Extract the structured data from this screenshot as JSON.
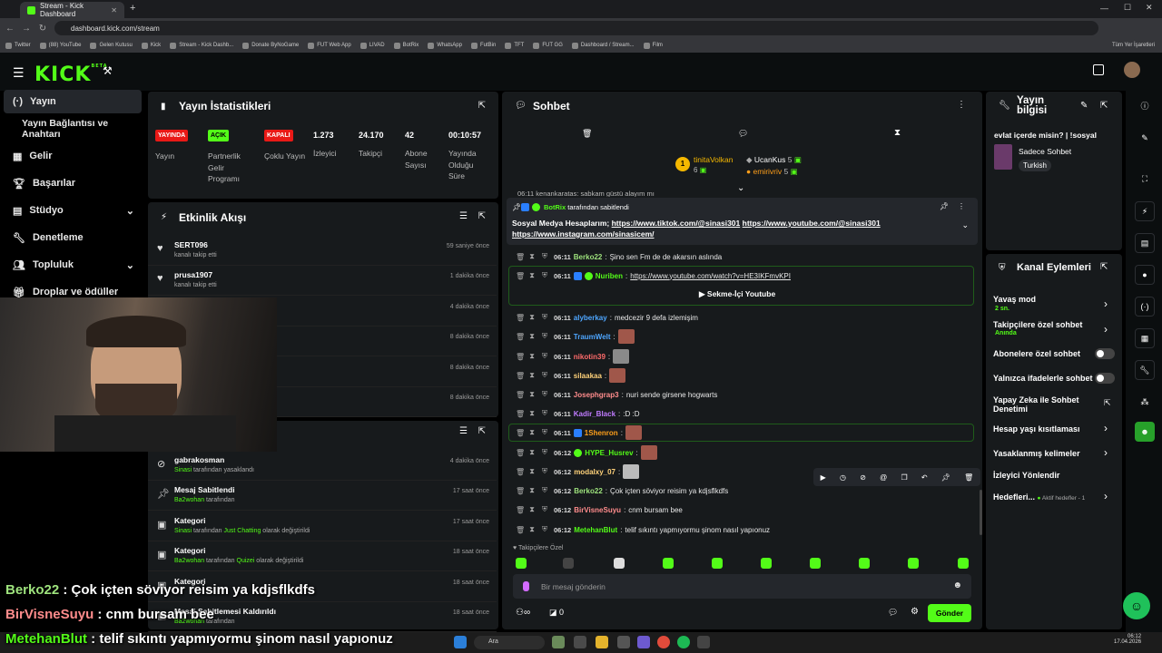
{
  "browser": {
    "tab_title": "Stream - Kick Dashboard",
    "url": "dashboard.kick.com/stream",
    "bookmarks": [
      "Twitter",
      "(88) YouTube",
      "Gelen Kutusu",
      "Kick",
      "Stream - Kick Dashb...",
      "Donate ByNoGame",
      "FUT Web App",
      "LIVAD",
      "BotRix",
      "WhatsApp",
      "FutBin",
      "TFT",
      "FUT GG",
      "Dashboard / Stream...",
      "Film"
    ],
    "all_bookmarks": "Tüm Yer İşaretleri"
  },
  "header": {
    "logo": "KICK",
    "logo_beta": "BETA"
  },
  "sidebar": {
    "items": [
      {
        "label": "Yayın",
        "icon": "broadcast-icon"
      },
      {
        "label": "Yayın Bağlantısı ve Anahtarı"
      },
      {
        "label": "Gelir",
        "icon": "revenue-icon"
      },
      {
        "label": "Başarılar",
        "icon": "trophy-icon"
      },
      {
        "label": "Stüdyo",
        "icon": "studio-icon"
      },
      {
        "label": "Denetleme",
        "icon": "wrench-icon"
      },
      {
        "label": "Topluluk",
        "icon": "community-icon"
      },
      {
        "label": "Droplar ve ödüller",
        "icon": "gift-icon"
      }
    ]
  },
  "stats": {
    "title": "Yayın İstatistikleri",
    "cells": [
      {
        "badge": "YAYINDA",
        "label": "Yayın",
        "color": "#e91916"
      },
      {
        "badge": "AÇIK",
        "label": "Partnerlik Gelir Programı",
        "color": "#53fc18"
      },
      {
        "badge": "KAPALI",
        "label": "Çoklu Yayın",
        "color": "#e91916"
      },
      {
        "value": "1.273",
        "label": "İzleyici"
      },
      {
        "value": "24.170",
        "label": "Takipçi"
      },
      {
        "value": "42",
        "label": "Abone Sayısı"
      },
      {
        "value": "00:10:57",
        "label": "Yayında Olduğu Süre"
      }
    ]
  },
  "activity": {
    "title": "Etkinlik Akışı",
    "rows": [
      {
        "name": "SERT096",
        "sub": "kanalı takip etti",
        "time": "59 saniye önce"
      },
      {
        "name": "prusa1907",
        "sub": "kanalı takip etti",
        "time": "1 dakika önce"
      },
      {
        "time": "4 dakika önce"
      },
      {
        "time": "8 dakika önce"
      },
      {
        "time": "8 dakika önce"
      },
      {
        "time": "8 dakika önce"
      }
    ]
  },
  "modlog": {
    "rows": [
      {
        "title": "gabrakosman",
        "sub_a": "Sinasi",
        "sub_b": " tarafından yasaklandı",
        "time": "4 dakika önce"
      },
      {
        "title": "Mesaj Sabitlendi",
        "sub_a": "Ba2wohan",
        "sub_b": " tarafından",
        "time": "17 saat önce"
      },
      {
        "title": "Kategori",
        "sub_a": "Sinasi",
        "sub_b": " tarafından ",
        "sub_c": "Just Chatting",
        "sub_d": " olarak değiştirildi",
        "time": "17 saat önce"
      },
      {
        "title": "Kategori",
        "sub_a": "Ba2wohan",
        "sub_b": " tarafından ",
        "sub_c": "Quizei",
        "sub_d": " olarak değiştirildi",
        "time": "18 saat önce"
      },
      {
        "title": "Kategori",
        "time": "18 saat önce"
      },
      {
        "title": "Mesaj Sabitlemesi Kaldırıldı",
        "sub_a": "Ba2wohan",
        "sub_b": " tarafından",
        "time": "18 saat önce"
      }
    ]
  },
  "chat": {
    "title": "Sohbet",
    "gifters": [
      {
        "name": "tinitaVolkan",
        "count": "6"
      },
      {
        "name": "UcanKus",
        "count": "5"
      },
      {
        "name": "emirivriv",
        "count": "5"
      }
    ],
    "pinned": {
      "by_name": "BotRix",
      "by_text": "tarafından sabitlendi",
      "prefix": "Sosyal Medya Hesaplarım; ",
      "link1": "https://www.tiktok.com/@sinasi301",
      "link2": "https://www.youtube.com/@sinasi301",
      "link3": "https://www.instagram.com/sinasicem/"
    },
    "truncated_line": "06:11 kenankaratas: sabkam güstü alayım mı",
    "messages": [
      {
        "time": "06:11",
        "user": "Berko22",
        "color": "#9ee37d",
        "text": "Şino sen Fm de de akarsın aslında"
      },
      {
        "time": "06:11",
        "user": "Nuriben",
        "color": "#53fc18",
        "text": "https://www.youtube.com/watch?v=HE3IKFmvKPI"
      },
      {
        "time": "06:11",
        "user": "alyberkay",
        "color": "#4ea6ff",
        "text": "medcezir 9 defa izlemişim"
      },
      {
        "time": "06:11",
        "user": "TraumWelt",
        "color": "#4ea6ff",
        "text": ""
      },
      {
        "time": "06:11",
        "user": "nikotin39",
        "color": "#ff6b6b",
        "text": ""
      },
      {
        "time": "06:11",
        "user": "silaakaa",
        "color": "#ffd27a",
        "text": ""
      },
      {
        "time": "06:11",
        "user": "Josephgrap3",
        "color": "#ff8c8c",
        "text": "nuri sende girsene hogwarts"
      },
      {
        "time": "06:11",
        "user": "Kadir_Black",
        "color": "#c07bff",
        "text": ":D :D"
      },
      {
        "time": "06:11",
        "user": "1Shenron",
        "color": "#ff9f1a",
        "text": ""
      },
      {
        "time": "06:12",
        "user": "HYPE_Husrev",
        "color": "#53fc18",
        "text": ""
      },
      {
        "time": "06:12",
        "user": "modalxy_07",
        "color": "#ffd27a",
        "text": ""
      },
      {
        "time": "06:12",
        "user": "Berko22",
        "color": "#9ee37d",
        "text": "Çok içten söviyor reisim ya kdjsflkdfs"
      },
      {
        "time": "06:12",
        "user": "BirVisneSuyu",
        "color": "#ff8c8c",
        "text": "cnm bursam bee"
      },
      {
        "time": "06:12",
        "user": "MetehanBlut",
        "color": "#53fc18",
        "text": "telif sıkıntı yapmıyormu şinom nasıl yapıonuz"
      }
    ],
    "youtube_button": "Sekme-İçi Youtube",
    "followers_only": "Takipçilere Özel",
    "input_placeholder": "Bir mesaj gönderin",
    "points": "0",
    "send": "Gönder"
  },
  "info": {
    "title": "Yayın bilgisi",
    "stream_title": "evlat içerde misin? | !sosyal",
    "category": "Sadece Sohbet",
    "language": "Turkish"
  },
  "actions": {
    "title": "Kanal Eylemleri",
    "slow_mode": "Yavaş mod",
    "slow_val": "2 sn.",
    "followers": "Takipçilere özel sohbet",
    "followers_val": "Anında",
    "subs": "Abonelere özel sohbet",
    "emotes": "Yalnızca ifadelerle sohbet",
    "ai": "Yapay Zeka ile Sohbet Denetimi",
    "age": "Hesap yaşı kısıtlaması",
    "banned": "Yasaklanmış kelimeler",
    "redirect": "İzleyici Yönlendir",
    "goals": "Hedefleri...",
    "goals_val": "Aktif hedefler - 1"
  },
  "overlay": {
    "captions": [
      {
        "user": "Berko22",
        "text": " : Çok içten söviyor reisim ya kdjsflkdfs",
        "color": "#9ee37d"
      },
      {
        "user": "BirVisneSuyu",
        "text": " : cnm bursam bee",
        "color": "#ff8c8c"
      },
      {
        "user": "MetehanBlut",
        "text": " : telif sıkıntı yapmıyormu şinom nasıl yapıonuz",
        "color": "#53fc18"
      }
    ]
  },
  "taskbar": {
    "search": "Ara",
    "time": "06:12",
    "date": "17.04.2026"
  }
}
